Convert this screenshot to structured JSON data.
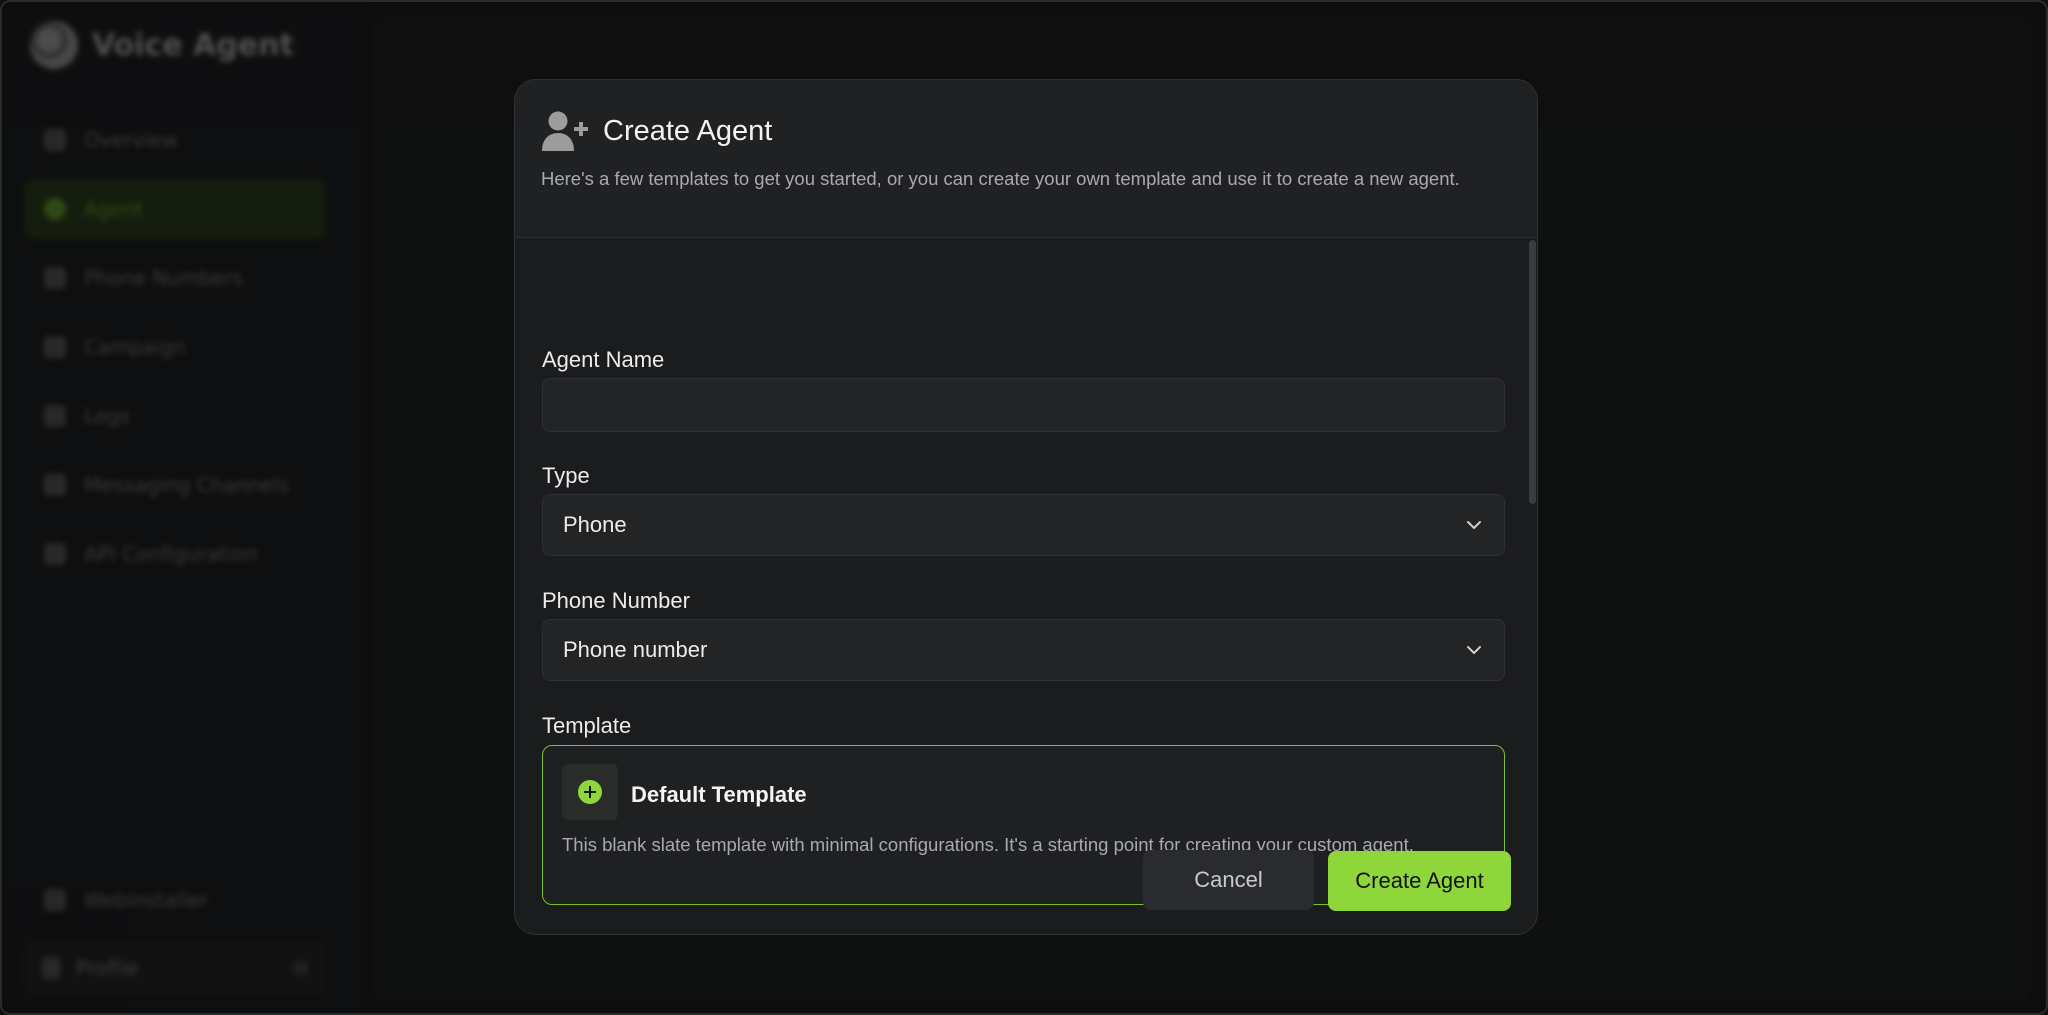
{
  "app": {
    "brand_name": "Voice Agent"
  },
  "sidebar": {
    "items": [
      {
        "label": "Overview",
        "icon": "grid-icon"
      },
      {
        "label": "Agent",
        "icon": "agent-icon",
        "active": true
      },
      {
        "label": "Phone Numbers",
        "icon": "phone-icon"
      },
      {
        "label": "Campaign",
        "icon": "campaign-icon"
      },
      {
        "label": "Logs",
        "icon": "logs-icon"
      },
      {
        "label": "Messaging Channels",
        "icon": "message-icon"
      },
      {
        "label": "API Configuration",
        "icon": "api-icon"
      }
    ],
    "bottom_item": {
      "label": "Webinstaller",
      "icon": "webhook-icon"
    },
    "profile": {
      "label": "Profile",
      "icon": "user-icon"
    }
  },
  "modal": {
    "title": "Create Agent",
    "title_icon": "user-plus-icon",
    "subtitle": "Here's a few templates to get you started, or you can create your own template and use it to create a new agent.",
    "fields": {
      "agent_name": {
        "label": "Agent Name",
        "value": "",
        "placeholder": ""
      },
      "type": {
        "label": "Type",
        "value": "Phone"
      },
      "phone_number": {
        "label": "Phone Number",
        "value": "Phone number"
      },
      "template": {
        "label": "Template"
      }
    },
    "template_card": {
      "title": "Default Template",
      "description": "This blank slate template with minimal configurations. It's a starting point for creating your custom agent.",
      "icon": "plus-circle-icon"
    },
    "buttons": {
      "cancel": "Cancel",
      "create": "Create Agent"
    }
  },
  "colors": {
    "accent": "#8fd63a",
    "modal_bg": "#1b1c1e",
    "card_border": "#7fbf2a"
  }
}
